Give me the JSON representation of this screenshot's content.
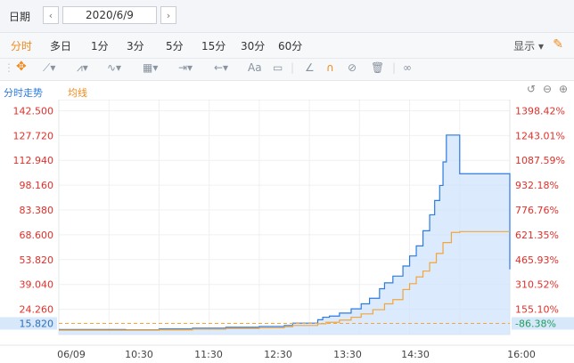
{
  "date_bar": {
    "label": "日期",
    "prev_icon": "‹",
    "date": "2020/6/9",
    "next_icon": "›"
  },
  "periods": [
    {
      "label": "分时",
      "active": true
    },
    {
      "label": "多日",
      "active": false
    },
    {
      "label": "1分",
      "active": false
    },
    {
      "label": "3分",
      "active": false
    },
    {
      "label": "5分",
      "active": false
    },
    {
      "label": "15分",
      "active": false
    },
    {
      "label": "30分",
      "active": false
    },
    {
      "label": "60分",
      "active": false
    }
  ],
  "display_menu": "显示",
  "toolbar_text_tool": "Aa",
  "chart_header": {
    "tab_trend": "分时走势",
    "tab_avg": "均线"
  },
  "colors": {
    "price_line": "#2e7be0",
    "avg_line": "#f3a53a",
    "fill": "#cfe3fb",
    "up": "#e0302a",
    "down": "#1f9e5a",
    "current_tag": "#d7e8fb"
  },
  "chart_data": {
    "type": "line",
    "title": "",
    "xlabel": "",
    "ylabel": "",
    "x_ticks": [
      "06/09",
      "10:30",
      "11:30",
      "12:30",
      "13:30",
      "14:30",
      "16:00"
    ],
    "x_range": [
      0,
      270
    ],
    "ylim": [
      9.2,
      149.1
    ],
    "y_left_ticks": [
      "142.500",
      "127.720",
      "112.940",
      "98.160",
      "83.380",
      "68.600",
      "53.820",
      "39.040",
      "24.260"
    ],
    "y_right_ticks": [
      "1398.42%",
      "1243.01%",
      "1087.59%",
      "932.18%",
      "776.76%",
      "621.35%",
      "465.93%",
      "310.52%",
      "155.10%"
    ],
    "reference_value": 15.82,
    "reference_label": "15.820",
    "reference_pct_label": "-86.38%",
    "series": [
      {
        "x": [
          0,
          20,
          40,
          55,
          60,
          80,
          100,
          120,
          135,
          140,
          155,
          158,
          162,
          168,
          175,
          181,
          186,
          192,
          195,
          200,
          206,
          210,
          214,
          218,
          222,
          225,
          228,
          230,
          232,
          240,
          250,
          260,
          266,
          269,
          270
        ],
        "y": [
          12.2,
          12.2,
          12.0,
          12.0,
          12.5,
          13.0,
          13.5,
          14.0,
          14.6,
          16.0,
          18.0,
          19.5,
          20.2,
          22.0,
          24.5,
          27.5,
          30.8,
          36.5,
          40.0,
          44.0,
          50.0,
          56.0,
          62.0,
          71.0,
          80.5,
          89.0,
          98.0,
          112.0,
          128.0,
          105.0,
          105.0,
          105.0,
          105.0,
          105.0,
          48.0
        ]
      },
      {
        "x": [
          0,
          20,
          40,
          55,
          60,
          80,
          100,
          120,
          135,
          140,
          155,
          160,
          168,
          175,
          181,
          188,
          195,
          200,
          206,
          210,
          214,
          218,
          222,
          226,
          230,
          235,
          240,
          250,
          260,
          270
        ],
        "y": [
          11.8,
          11.8,
          11.8,
          11.8,
          12.0,
          12.4,
          12.8,
          13.2,
          13.8,
          14.6,
          15.6,
          16.5,
          17.8,
          19.5,
          21.5,
          24.0,
          27.5,
          30.0,
          36.0,
          39.5,
          43.5,
          47.0,
          52.0,
          57.5,
          64.0,
          70.0,
          70.5,
          70.5,
          70.5,
          70.5
        ]
      }
    ]
  }
}
